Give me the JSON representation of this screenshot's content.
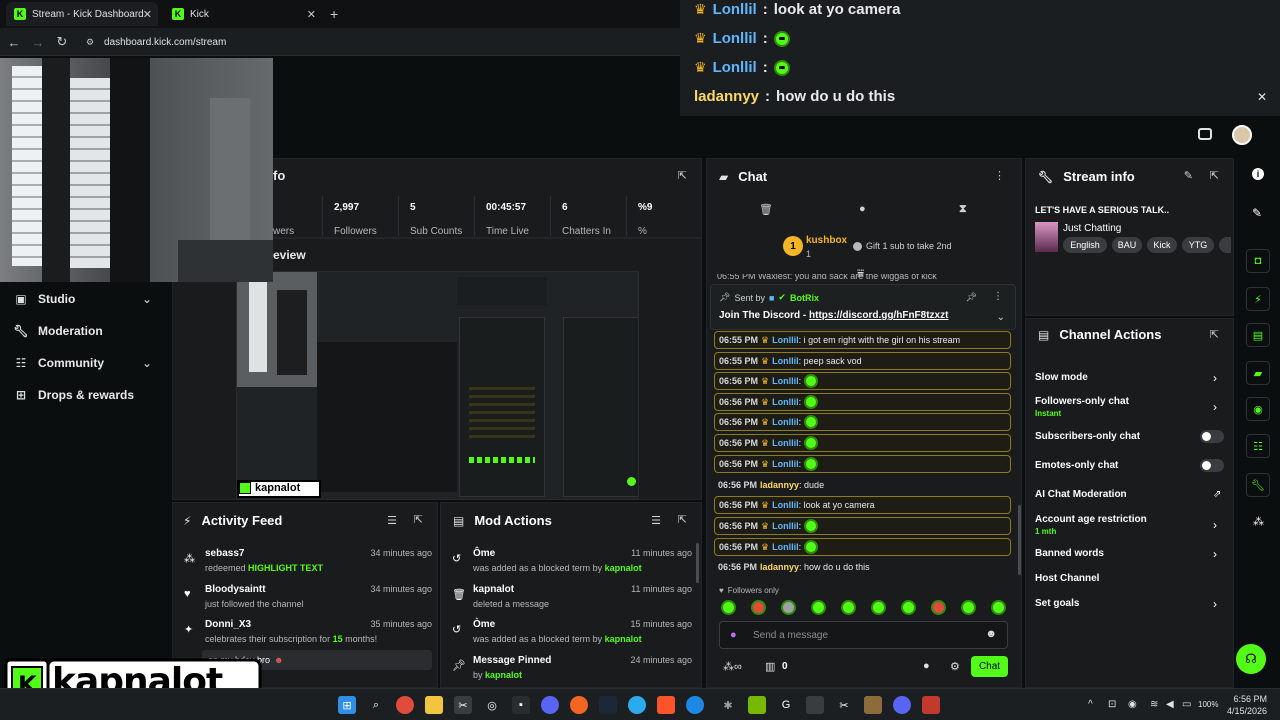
{
  "browser": {
    "tabs": [
      {
        "title": "Stream - Kick Dashboard",
        "active": true
      },
      {
        "title": "Kick",
        "active": false
      }
    ],
    "url": "dashboard.kick.com/stream"
  },
  "popout_chat": {
    "messages": [
      {
        "user": "Lonllil",
        "text": "look at yo camera",
        "has_crown": true,
        "has_emote": false
      },
      {
        "user": "Lonllil",
        "text": "",
        "has_crown": true,
        "has_emote": true
      },
      {
        "user": "Lonllil",
        "text": "",
        "has_crown": true,
        "has_emote": true
      },
      {
        "user": "ladannyy",
        "text": "how do u do this",
        "has_crown": false,
        "has_emote": false
      }
    ]
  },
  "sidebar": {
    "items": [
      {
        "label": "Studio",
        "icon": "studio-icon",
        "chevron": true
      },
      {
        "label": "Moderation",
        "icon": "wrench-icon",
        "chevron": false
      },
      {
        "label": "Community",
        "icon": "community-icon",
        "chevron": true
      },
      {
        "label": "Drops & rewards",
        "icon": "gift-icon",
        "chevron": false
      }
    ]
  },
  "stream_panel": {
    "title_fragment": "fo",
    "stats": [
      {
        "value": "",
        "label": "wers"
      },
      {
        "value": "2,997",
        "label": "Followers"
      },
      {
        "value": "5",
        "label": "Sub Counts"
      },
      {
        "value": "00:45:57",
        "label": "Time Live"
      },
      {
        "value": "6",
        "label": "Chatters In"
      },
      {
        "value": "%9",
        "label": "%"
      }
    ],
    "preview_title_fragment": "eview"
  },
  "activity_feed": {
    "title": "Activity Feed",
    "items": [
      {
        "name": "sebass7",
        "desc_prefix": "redeemed ",
        "desc_highlight": "HIGHLIGHT TEXT",
        "desc_suffix": "",
        "time": "34 minutes ago",
        "icon": "points-icon"
      },
      {
        "name": "Bloodysaintt",
        "desc_prefix": "just followed the channel",
        "desc_highlight": "",
        "desc_suffix": "",
        "time": "34 minutes ago",
        "icon": "heart-icon"
      },
      {
        "name": "Donni_X3",
        "desc_prefix": "celebrates their subscription for ",
        "desc_highlight": "15",
        "desc_suffix": " months!",
        "time": "35 minutes ago",
        "icon": "star-icon",
        "message": "an my bday bro"
      }
    ]
  },
  "mod_actions": {
    "title": "Mod Actions",
    "items": [
      {
        "name": "Ôme",
        "desc": "was added as a blocked term by ",
        "by": "kapnalot",
        "time": "11 minutes ago",
        "icon": "undo-icon"
      },
      {
        "name": "kapnalot",
        "desc": "deleted a message",
        "by": "",
        "time": "11 minutes ago",
        "icon": "trash-icon"
      },
      {
        "name": "Òme",
        "desc": "was added as a blocked term by ",
        "by": "kapnalot",
        "time": "15 minutes ago",
        "icon": "undo-icon"
      },
      {
        "name": "Message Pinned",
        "desc": "by ",
        "by": "kapnalot",
        "time": "24 minutes ago",
        "icon": "pin-icon"
      }
    ]
  },
  "chat": {
    "title": "Chat",
    "top_gifter": {
      "rank": "1",
      "name": "kushbox",
      "count": "1",
      "hint": "Gift 1 sub to take 2nd"
    },
    "cut_line": "06:55 PM  Waxiest: you and sack are the wiggas of kick",
    "pinned": {
      "sent_by_label": "Sent by",
      "sender": "BotRix",
      "text": "Join The Discord - ",
      "link": "https://discord.gg/hFnF8tzxzt"
    },
    "messages": [
      {
        "time": "06:55 PM",
        "user": "Lonllil",
        "text": ": i got em right with the girl on his stream",
        "crown": true,
        "emote": false,
        "box": true,
        "ucls": "u1"
      },
      {
        "time": "06:55 PM",
        "user": "Lonllil",
        "text": ": peep sack vod",
        "crown": true,
        "emote": false,
        "box": true,
        "ucls": "u1"
      },
      {
        "time": "06:56 PM",
        "user": "Lonllil",
        "text": ":",
        "crown": true,
        "emote": true,
        "box": true,
        "ucls": "u1"
      },
      {
        "time": "06:56 PM",
        "user": "Lonllil",
        "text": ":",
        "crown": true,
        "emote": true,
        "box": true,
        "ucls": "u1"
      },
      {
        "time": "06:56 PM",
        "user": "Lonllil",
        "text": ":",
        "crown": true,
        "emote": true,
        "box": true,
        "ucls": "u1"
      },
      {
        "time": "06:56 PM",
        "user": "Lonllil",
        "text": ":",
        "crown": true,
        "emote": true,
        "box": true,
        "ucls": "u1"
      },
      {
        "time": "06:56 PM",
        "user": "Lonllil",
        "text": ":",
        "crown": true,
        "emote": true,
        "box": true,
        "ucls": "u1"
      },
      {
        "time": "06:56 PM",
        "user": "ladannyy",
        "text": ": dude",
        "crown": false,
        "emote": false,
        "box": false,
        "ucls": "u2"
      },
      {
        "time": "06:56 PM",
        "user": "Lonllil",
        "text": ": look at yo camera",
        "crown": true,
        "emote": false,
        "box": true,
        "ucls": "u1"
      },
      {
        "time": "06:56 PM",
        "user": "Lonllil",
        "text": ":",
        "crown": true,
        "emote": true,
        "box": true,
        "ucls": "u1"
      },
      {
        "time": "06:56 PM",
        "user": "Lonllil",
        "text": ":",
        "crown": true,
        "emote": true,
        "box": true,
        "ucls": "u1"
      },
      {
        "time": "06:56 PM",
        "user": "ladannyy",
        "text": ": how do u do this",
        "crown": false,
        "emote": false,
        "box": false,
        "ucls": "u2"
      }
    ],
    "followers_only": "Followers only",
    "input_placeholder": "Send a message",
    "send_label": "Chat",
    "points": "0"
  },
  "stream_info": {
    "title": "Stream info",
    "stream_title": "LET'S HAVE A SERIOUS TALK..",
    "category": "Just Chatting",
    "tags": [
      "English",
      "BAU",
      "Kick",
      "YTG"
    ]
  },
  "channel_actions": {
    "title": "Channel Actions",
    "items": [
      {
        "label": "Slow mode",
        "sub": "",
        "control": "chevron"
      },
      {
        "label": "Followers-only chat",
        "sub": "Instant",
        "control": "chevron"
      },
      {
        "label": "Subscribers-only chat",
        "sub": "",
        "control": "toggle"
      },
      {
        "label": "Emotes-only chat",
        "sub": "",
        "control": "toggle"
      },
      {
        "label": "AI Chat Moderation",
        "sub": "",
        "control": "external"
      },
      {
        "label": "Account age restriction",
        "sub": "1 mth",
        "control": "chevron"
      },
      {
        "label": "Banned words",
        "sub": "",
        "control": "chevron"
      },
      {
        "label": "Host Channel",
        "sub": "",
        "control": "none"
      },
      {
        "label": "Set goals",
        "sub": "",
        "control": "chevron"
      }
    ]
  },
  "overlay_logo": {
    "text": "kapnalot"
  },
  "taskbar": {
    "time": "6:56 PM",
    "date": "4/15/2026",
    "battery": "100%"
  },
  "colors": {
    "kick_green": "#53fc18",
    "panel_bg": "#191b1c",
    "crown_gold": "#f5b625",
    "user_blue": "#5fb7ff"
  }
}
